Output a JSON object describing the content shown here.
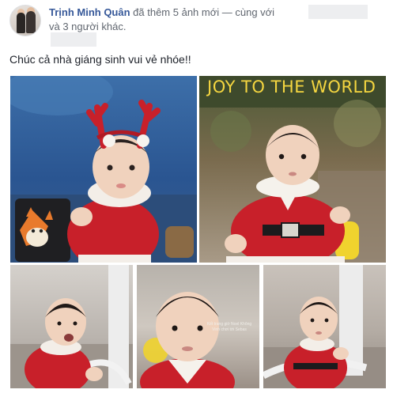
{
  "post": {
    "author": "Trịnh Minh Quân",
    "action": " đã thêm 5 ảnh mới — cùng với",
    "tagged_suffix": "và 3 người khác.",
    "text": "Chúc cả nhà giáng sinh vui vẻ nhóe!!"
  },
  "photos": [
    {
      "name": "baby-reindeer-headband"
    },
    {
      "name": "baby-joy-to-the-world",
      "caption": "JOY TO THE WORLD"
    },
    {
      "name": "baby-crying-walker"
    },
    {
      "name": "baby-closeup",
      "watermark": "Kết trang giờ Noel Không Vinh chơi tới Sebas"
    },
    {
      "name": "baby-walker-smiling"
    }
  ],
  "colors": {
    "author_link": "#365899",
    "secondary_text": "#616770",
    "santa_red": "#c8202a",
    "caption_yellow": "#f5d640"
  }
}
